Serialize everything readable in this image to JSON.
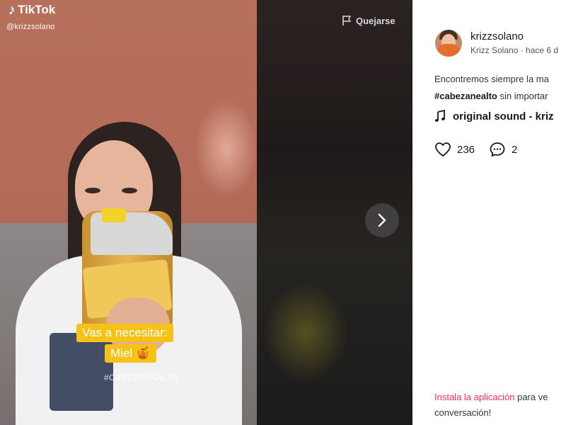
{
  "video": {
    "logo_text": "TikTok",
    "watermark_user": "@krizzsolano",
    "caption_line1": "Vas a necesitar:",
    "caption_line2": "Miel 🍯",
    "hashtag_overlay": "#CABEZAENALTO"
  },
  "player": {
    "report_label": "Quejarse"
  },
  "post": {
    "username": "krizzsolano",
    "display_name": "Krizz Solano",
    "time_ago": "· hace 6 d",
    "description_line1": "Encontremos siempre la ma",
    "hashtag": "#cabezanealto",
    "description_line2_rest": "sin importar",
    "sound": "original sound - kriz",
    "likes": "236",
    "comments": "2"
  },
  "install_prompt": {
    "link_text": "Instala la aplicación",
    "rest_line1": "para ve",
    "line2": "conversación!"
  }
}
